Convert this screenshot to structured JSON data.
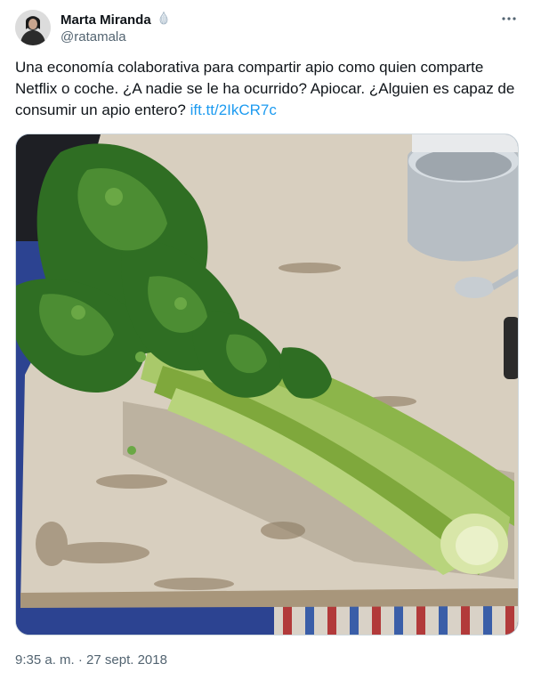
{
  "author": {
    "name": "Marta Miranda",
    "handle": "@ratamala",
    "avatar": "avatar"
  },
  "tweet": {
    "text": "Una economía colaborativa para compartir apio como quien comparte Netflix o coche. ¿A nadie se le ha ocurrido? Apiocar. ¿Alguien es capaz de consumir un apio entero?",
    "link_text": "ift.tt/2IkCR7c"
  },
  "timestamp": "9:35 a. m. · 27 sept. 2018",
  "icons": {
    "badge": "garlic-badge-icon",
    "more": "more-horizontal-icon"
  },
  "colors": {
    "link": "#1d9bf0",
    "secondary_text": "#536471",
    "primary_text": "#0f1419"
  }
}
